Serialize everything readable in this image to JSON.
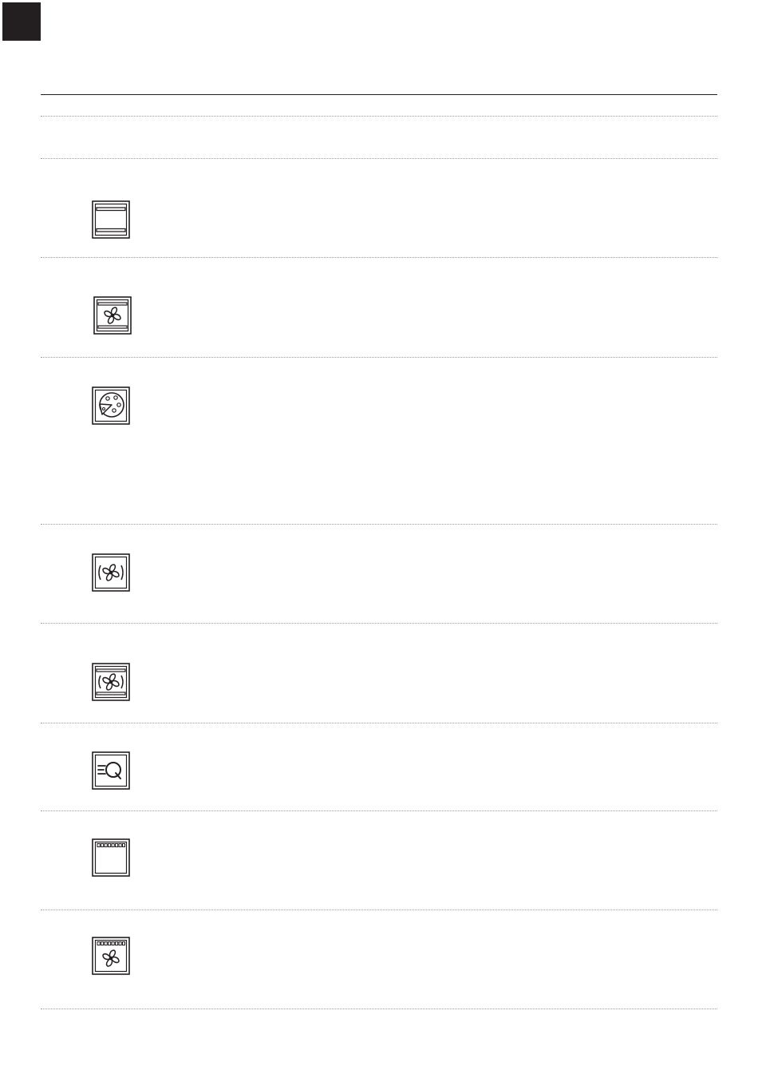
{
  "page": {
    "corner_tab_color": "#231f20",
    "rule_color": "#231f20",
    "dotted_rule_color": "#9a9a9a"
  },
  "functions": [
    {
      "icon": "conventional-oven-icon"
    },
    {
      "icon": "fan-oven-top-bottom-heat-icon"
    },
    {
      "icon": "pizza-function-icon"
    },
    {
      "icon": "hot-air-fan-icon"
    },
    {
      "icon": "hot-air-top-bottom-heat-icon"
    },
    {
      "icon": "rapid-defrost-icon"
    },
    {
      "icon": "grill-icon"
    },
    {
      "icon": "fan-grill-icon"
    }
  ]
}
